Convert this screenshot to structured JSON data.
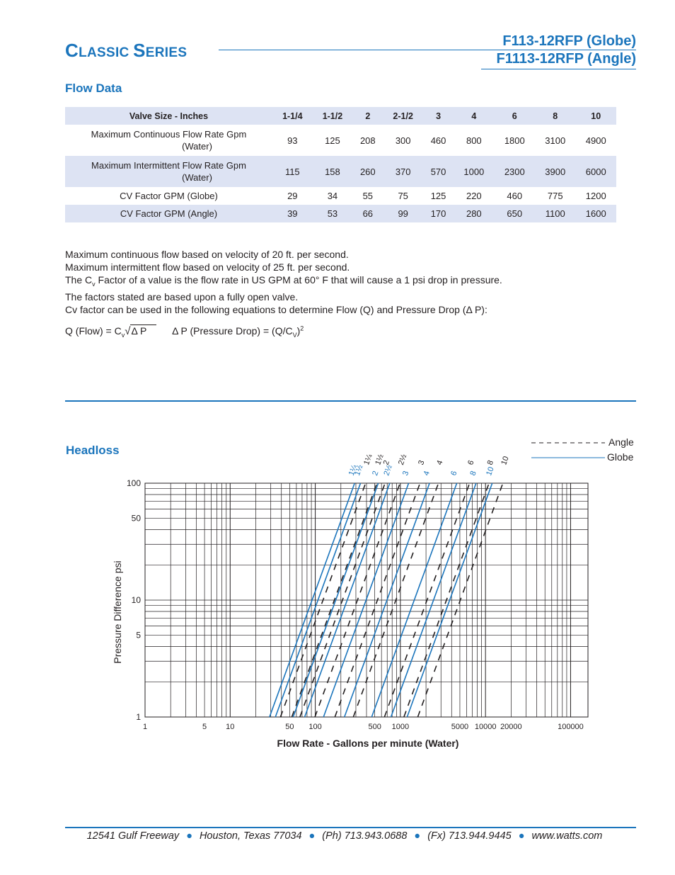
{
  "header": {
    "series_title_first": "C",
    "series_title_rest1": "LASSIC ",
    "series_title_second": "S",
    "series_title_rest2": "ERIES",
    "model_globe": "F113-12RFP (Globe)",
    "model_angle": "F1113-12RFP (Angle)"
  },
  "flow_data": {
    "heading": "Flow Data",
    "columns": [
      "Valve Size - Inches",
      "1-1/4",
      "1-1/2",
      "2",
      "2-1/2",
      "3",
      "4",
      "6",
      "8",
      "10"
    ],
    "rows": [
      {
        "label_line1": "Maximum Continuous     Flow Rate Gpm",
        "label_line2": "(Water)",
        "values": [
          "93",
          "125",
          "208",
          "300",
          "460",
          "800",
          "1800",
          "3100",
          "4900"
        ]
      },
      {
        "label_line1": "Maximum Intermittent    Flow Rate Gpm",
        "label_line2": "(Water)",
        "values": [
          "115",
          "158",
          "260",
          "370",
          "570",
          "1000",
          "2300",
          "3900",
          "6000"
        ]
      },
      {
        "label_line1": "CV Factor GPM (Globe)",
        "label_line2": "",
        "values": [
          "29",
          "34",
          "55",
          "75",
          "125",
          "220",
          "460",
          "775",
          "1200"
        ]
      },
      {
        "label_line1": "CV Factor GPM (Angle)",
        "label_line2": "",
        "values": [
          "39",
          "53",
          "66",
          "99",
          "170",
          "280",
          "650",
          "1100",
          "1600"
        ]
      }
    ]
  },
  "notes": [
    "Maximum continuous flow based on velocity of 20 ft. per second.",
    "Maximum intermittent flow based on velocity of 25 ft. per second.",
    "The factors stated are based upon a fully open valve.",
    "Cv factor can be used in the following equations to determine Flow (Q) and Pressure Drop (Δ P):"
  ],
  "cv_note": {
    "before": "The C",
    "sub": "v",
    "after": " Factor of a value is the flow rate in US GPM at 60° F that will cause a 1 psi drop in pressure."
  },
  "formula": {
    "q_label": "Q (Flow) = C",
    "q_sub": "v",
    "q_root": "Δ P",
    "dp_label": "Δ P (Pressure Drop) = (Q/C",
    "dp_sub": "V",
    "dp_close": ")",
    "dp_sup": "2"
  },
  "headloss": {
    "heading": "Headloss",
    "legend_angle": "Angle",
    "legend_globe": "Globe"
  },
  "chart_data": {
    "type": "line",
    "title": "Headloss",
    "xlabel": "Flow Rate - Gallons per minute (Water)",
    "ylabel": "Pressure Difference psi",
    "xscale": "log",
    "yscale": "log",
    "xlim": [
      1,
      160000
    ],
    "ylim": [
      1,
      100
    ],
    "x_ticks": [
      "1",
      "5",
      "10",
      "50",
      "100",
      "500",
      "1000",
      "5000",
      "10000",
      "20000",
      "100000"
    ],
    "x_tick_values": [
      1,
      5,
      10,
      50,
      100,
      500,
      1000,
      5000,
      10000,
      20000,
      100000
    ],
    "y_ticks": [
      "1",
      "5",
      "10",
      "50",
      "100"
    ],
    "y_tick_values": [
      1,
      5,
      10,
      50,
      100
    ],
    "grid": true,
    "legend": "top-right",
    "relation": "Q = Cv * sqrt(dP)",
    "series": [
      {
        "name": "Globe 1-1/4",
        "style": "solid",
        "label": "1¼",
        "cv": 29
      },
      {
        "name": "Globe 1-1/2",
        "style": "solid",
        "label": "1½",
        "cv": 34
      },
      {
        "name": "Globe 2",
        "style": "solid",
        "label": "2",
        "cv": 55
      },
      {
        "name": "Globe 2-1/2",
        "style": "solid",
        "label": "2½",
        "cv": 75
      },
      {
        "name": "Globe 3",
        "style": "solid",
        "label": "3",
        "cv": 125
      },
      {
        "name": "Globe 4",
        "style": "solid",
        "label": "4",
        "cv": 220
      },
      {
        "name": "Globe 6",
        "style": "solid",
        "label": "6",
        "cv": 460
      },
      {
        "name": "Globe 8",
        "style": "solid",
        "label": "8",
        "cv": 775
      },
      {
        "name": "Globe 10",
        "style": "solid",
        "label": "10",
        "cv": 1200
      },
      {
        "name": "Angle 1-1/4",
        "style": "dashed",
        "label": "1¼",
        "cv": 39
      },
      {
        "name": "Angle 1-1/2",
        "style": "dashed",
        "label": "1½",
        "cv": 53
      },
      {
        "name": "Angle 2",
        "style": "dashed",
        "label": "2",
        "cv": 66
      },
      {
        "name": "Angle 2-1/2",
        "style": "dashed",
        "label": "2½",
        "cv": 99
      },
      {
        "name": "Angle 3",
        "style": "dashed",
        "label": "3",
        "cv": 170
      },
      {
        "name": "Angle 4",
        "style": "dashed",
        "label": "4",
        "cv": 280
      },
      {
        "name": "Angle 6",
        "style": "dashed",
        "label": "6",
        "cv": 650
      },
      {
        "name": "Angle 8",
        "style": "dashed",
        "label": "8",
        "cv": 1100
      },
      {
        "name": "Angle 10",
        "style": "dashed",
        "label": "10",
        "cv": 1600
      }
    ]
  },
  "footer": {
    "address": "12541 Gulf Freeway",
    "city": "Houston, Texas 77034",
    "phone": "(Ph) 713.943.0688",
    "fax": "(Fx) 713.944.9445",
    "web": "www.watts.com",
    "bullet": "●"
  },
  "colors": {
    "brand_blue": "#1b75bc",
    "table_band": "#dde3f3",
    "text": "#231f20"
  }
}
